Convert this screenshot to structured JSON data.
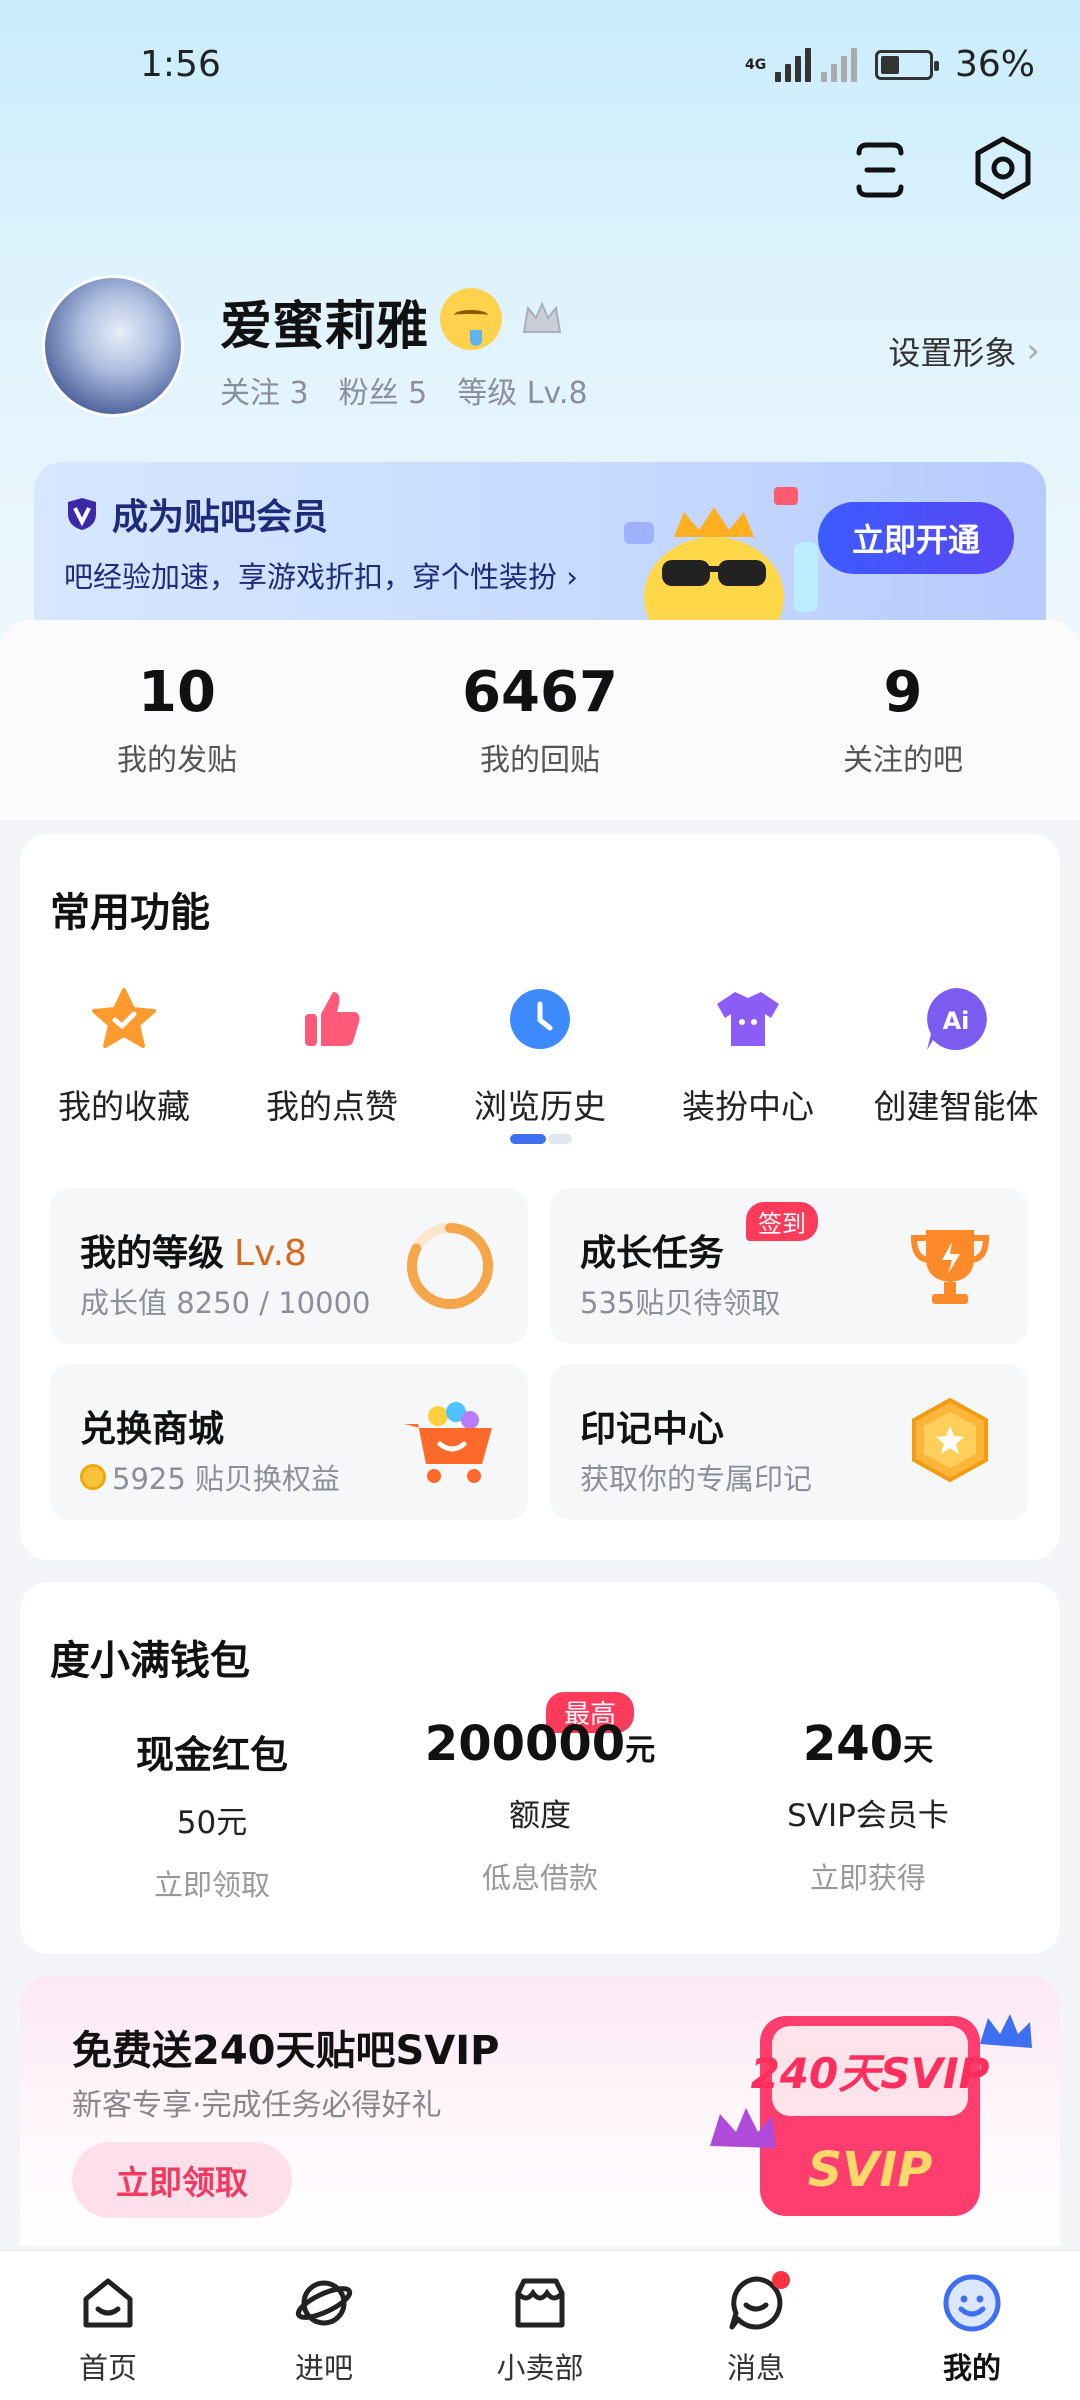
{
  "status_bar": {
    "time": "1:56",
    "network": "4G",
    "battery": "36%"
  },
  "profile": {
    "username": "爱蜜莉雅",
    "follow": "关注 3",
    "fans": "粉丝 5",
    "level": "等级 Lv.8",
    "set_avatar": "设置形象"
  },
  "vip_banner": {
    "title": "成为贴吧会员",
    "subtitle": "吧经验加速，享游戏折扣，穿个性装扮",
    "button": "立即开通"
  },
  "stats": [
    {
      "value": "10",
      "label": "我的发贴"
    },
    {
      "value": "6467",
      "label": "我的回贴"
    },
    {
      "value": "9",
      "label": "关注的吧"
    }
  ],
  "functions": {
    "title": "常用功能",
    "items": [
      {
        "label": "我的收藏",
        "icon": "star-icon"
      },
      {
        "label": "我的点赞",
        "icon": "thumbs-up-icon"
      },
      {
        "label": "浏览历史",
        "icon": "clock-icon"
      },
      {
        "label": "装扮中心",
        "icon": "tshirt-icon"
      },
      {
        "label": "创建智能体",
        "icon": "ai-chat-icon"
      }
    ],
    "tiles": [
      {
        "title": "我的等级",
        "level": "Lv.8",
        "sub": "成长值 8250 / 10000",
        "progress": 0.825
      },
      {
        "title": "成长任务",
        "badge": "签到",
        "sub": "535贴贝待领取"
      },
      {
        "title": "兑换商城",
        "sub": "5925 贴贝换权益"
      },
      {
        "title": "印记中心",
        "sub": "获取你的专属印记"
      }
    ]
  },
  "wallet": {
    "title": "度小满钱包",
    "tag": "最高",
    "cols": [
      {
        "top": "现金红包",
        "mid": "50元",
        "low": "立即领取"
      },
      {
        "amount": "200000",
        "unit": "元",
        "mid": "额度",
        "low": "低息借款"
      },
      {
        "amount": "240",
        "unit": "天",
        "mid": "SVIP会员卡",
        "low": "立即获得"
      }
    ]
  },
  "promo": {
    "title": "免费送240天贴吧SVIP",
    "subtitle": "新客专享·完成任务必得好礼",
    "button": "立即领取",
    "art_text_1": "240天SVIP",
    "art_text_2": "SVIP"
  },
  "tabs": [
    {
      "label": "首页"
    },
    {
      "label": "进吧"
    },
    {
      "label": "小卖部"
    },
    {
      "label": "消息"
    },
    {
      "label": "我的"
    }
  ],
  "colors": {
    "accent": "#3f6ff1",
    "vip_button": "#4a52f8",
    "badge_red": "#ff3b5c",
    "level_orange": "#d56a1e"
  }
}
